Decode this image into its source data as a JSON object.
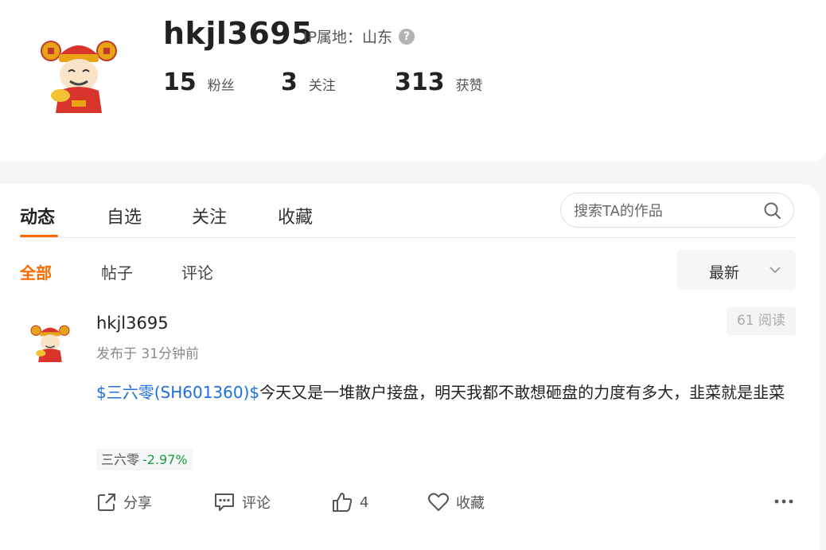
{
  "profile": {
    "username": "hkjl3695",
    "ip_label": "IP属地：山东",
    "help_icon": "?",
    "stats": [
      {
        "value": "15",
        "label": "粉丝"
      },
      {
        "value": "3",
        "label": "关注"
      },
      {
        "value": "313",
        "label": "获赞"
      }
    ]
  },
  "tabs": [
    "动态",
    "自选",
    "关注",
    "收藏"
  ],
  "search": {
    "placeholder": "搜索TA的作品"
  },
  "subtabs": [
    "全部",
    "帖子",
    "评论"
  ],
  "sort": {
    "label": "最新"
  },
  "post": {
    "username": "hkjl3695",
    "time": "发布于 31分钟前",
    "reads": "61 阅读",
    "stock_link": "$三六零(SH601360)$",
    "text": "今天又是一堆散户接盘，明天我都不敢想砸盘的力度有多大，韭菜就是韭菜",
    "stock_tag": {
      "name": "三六零",
      "change": "-2.97%"
    },
    "actions": {
      "share": "分享",
      "comment": "评论",
      "like": "4",
      "favorite": "收藏"
    }
  },
  "colors": {
    "accent": "#ff6a00",
    "link": "#1e6fe0",
    "down": "#1a9e3f"
  }
}
